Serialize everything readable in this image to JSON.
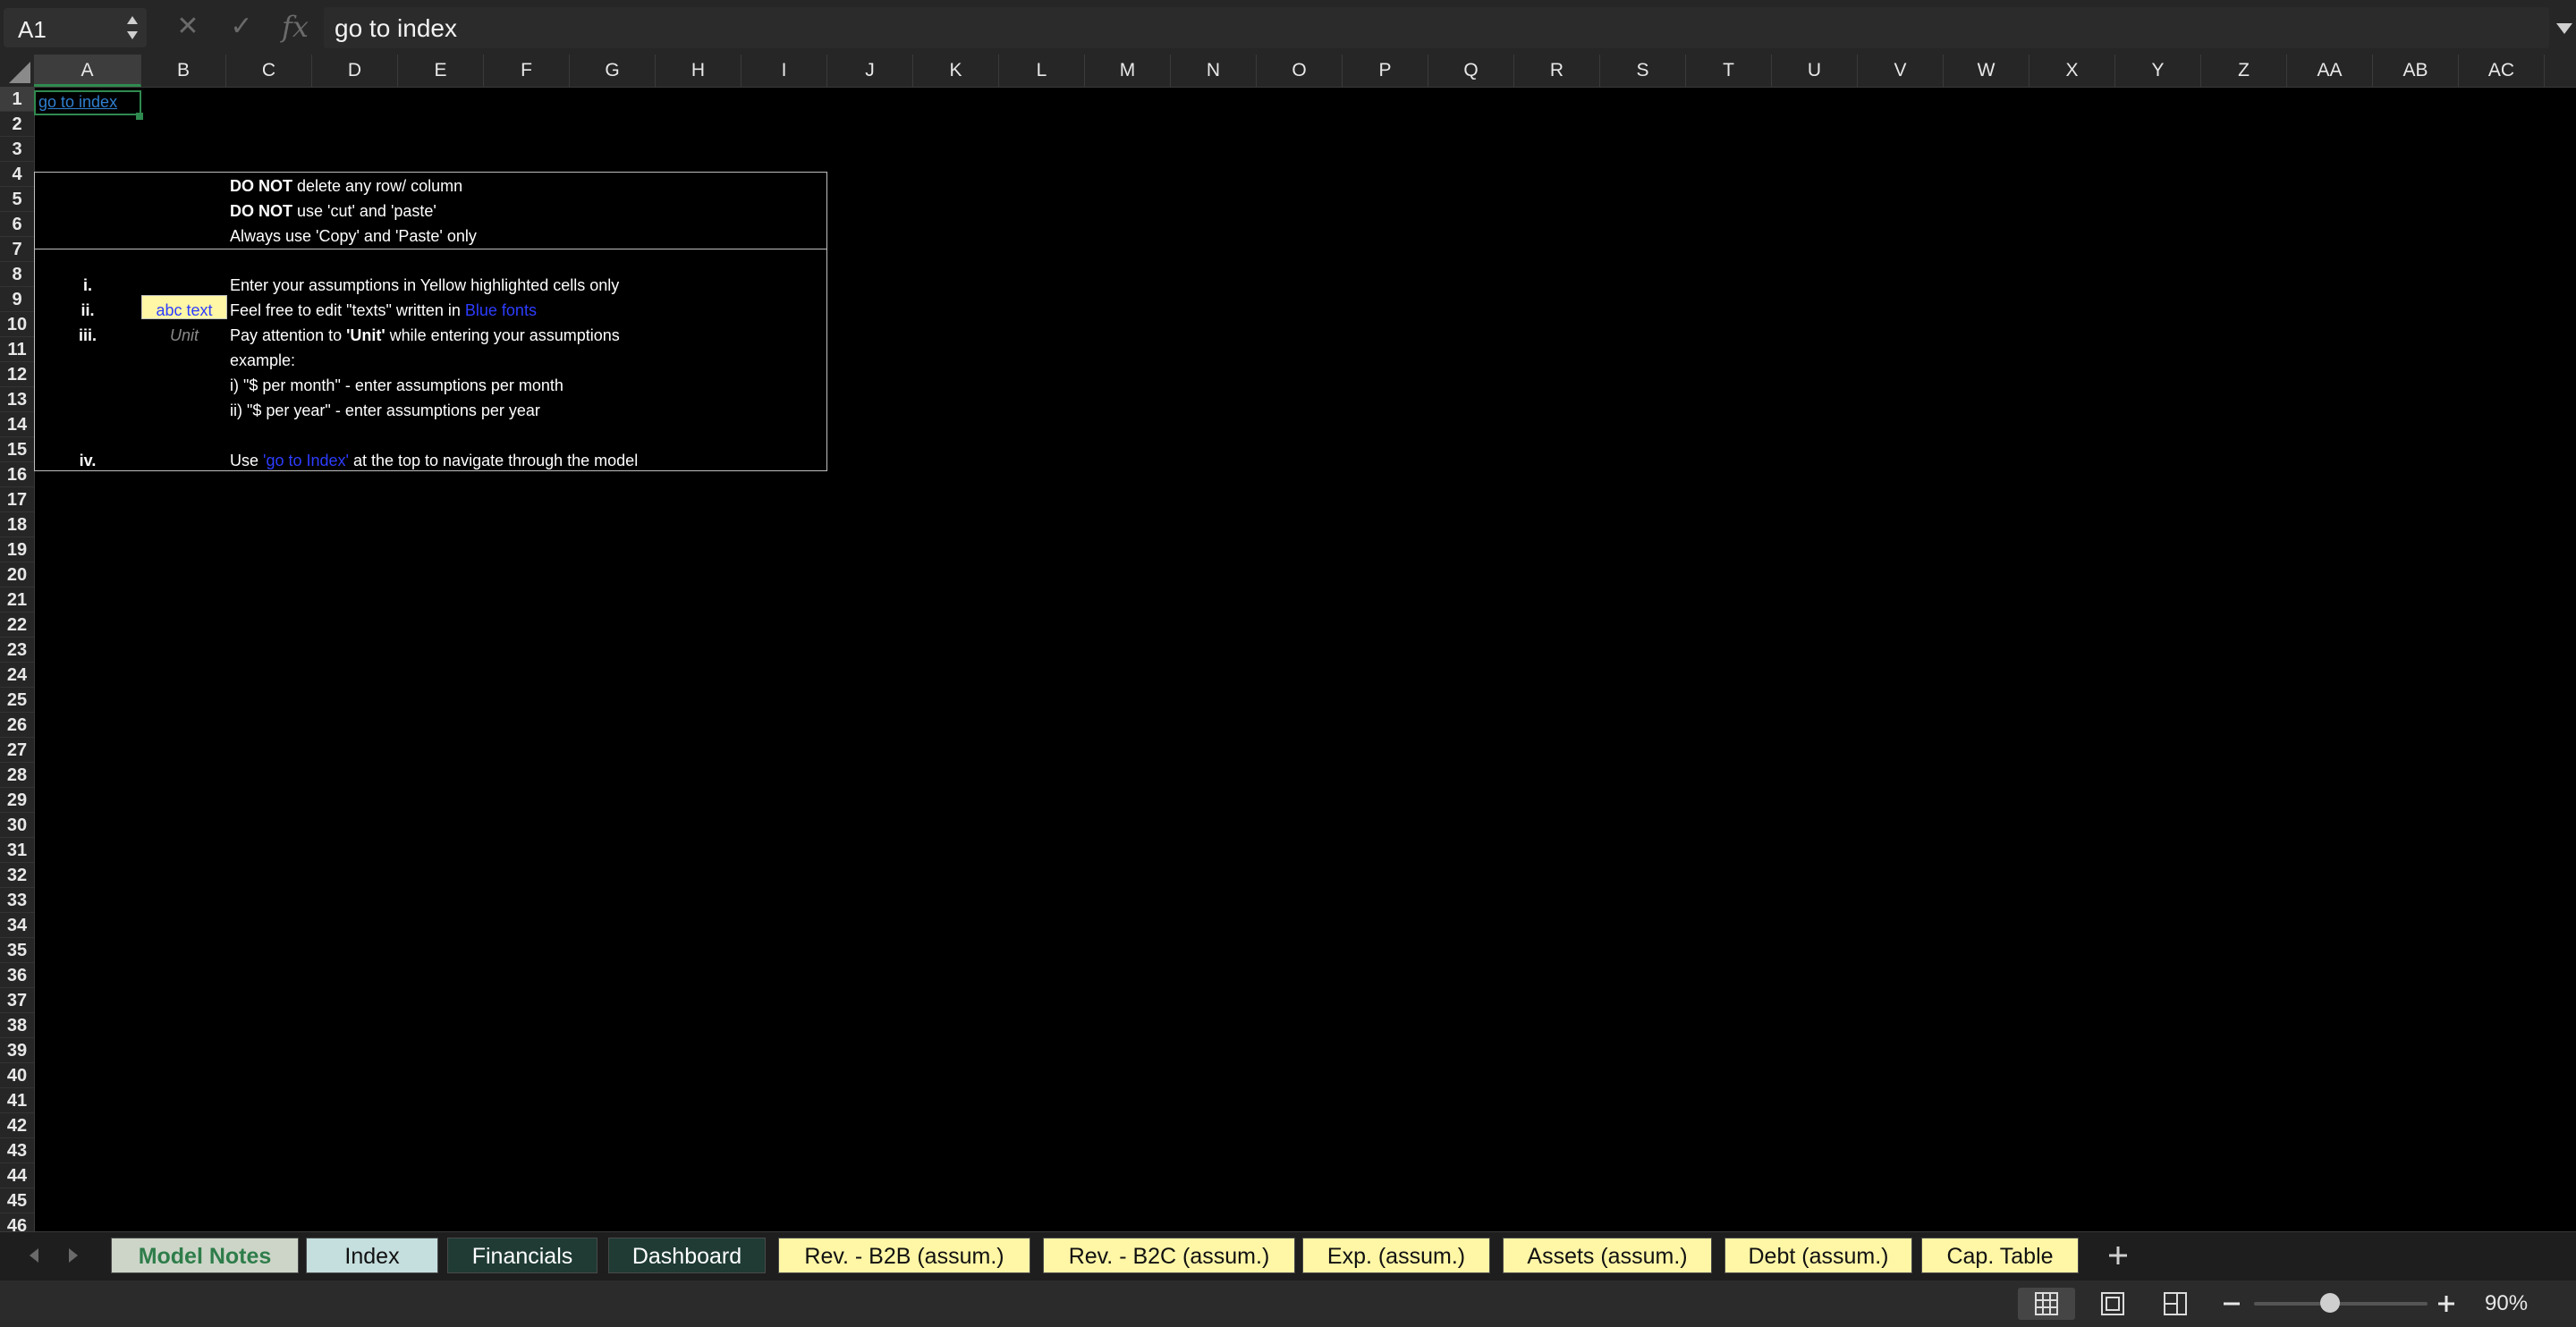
{
  "formula_bar": {
    "name_box": "A1",
    "formula": "go to index"
  },
  "columns": [
    "A",
    "B",
    "C",
    "D",
    "E",
    "F",
    "G",
    "H",
    "I",
    "J",
    "K",
    "L",
    "M",
    "N",
    "O",
    "P",
    "Q",
    "R",
    "S",
    "T",
    "U",
    "V",
    "W",
    "X",
    "Y",
    "Z",
    "AA",
    "AB",
    "AC"
  ],
  "rows": [
    "1",
    "2",
    "3",
    "4",
    "5",
    "6",
    "7",
    "8",
    "9",
    "10",
    "11",
    "12",
    "13",
    "14",
    "15",
    "16",
    "17",
    "18",
    "19",
    "20",
    "21",
    "22",
    "23",
    "24",
    "25",
    "26",
    "27",
    "28",
    "29",
    "30",
    "31",
    "32",
    "33",
    "34",
    "35",
    "36",
    "37",
    "38",
    "39",
    "40",
    "41",
    "42",
    "43",
    "44",
    "45",
    "46"
  ],
  "sheet": {
    "a1_link": "go to index",
    "warnings": {
      "r3_bold": "DO NOT",
      "r3_rest": " delete any row/ column",
      "r4_bold": "DO NOT",
      "r4_rest": " use 'cut' and 'paste'",
      "r5": "Always use 'Copy' and 'Paste' only"
    },
    "instructions": {
      "i_num": "i.",
      "i_text": "Enter your assumptions in Yellow highlighted cells only",
      "ii_num": "ii.",
      "ii_sample": "abc text",
      "ii_text_pre": "Feel free to edit \"texts\" written in ",
      "ii_text_blue": "Blue fonts",
      "iii_num": "iii.",
      "iii_sample": "Unit",
      "iii_text_pre": "Pay attention to ",
      "iii_text_bold": "'Unit'",
      "iii_text_post": " while entering your assumptions",
      "r10": "example:",
      "r11": "i)  \"$ per month\" - enter assumptions per month",
      "r12": "ii) \"$ per year\" - enter assumptions per year",
      "iv_num": "iv.",
      "iv_text_pre": "Use ",
      "iv_text_blue": "'go to Index'",
      "iv_text_post": " at the top to navigate through the model"
    }
  },
  "tabs": [
    {
      "label": "Model Notes",
      "bg": "#cdd5c8",
      "fg": "#2e7d4a",
      "active": true
    },
    {
      "label": "Index",
      "bg": "#c5dede",
      "fg": "#111111",
      "active": false
    },
    {
      "label": "Financials",
      "bg": "#1f3b34",
      "fg": "#ffffff",
      "active": false
    },
    {
      "label": "Dashboard",
      "bg": "#1f3b34",
      "fg": "#ffffff",
      "active": false
    },
    {
      "label": "Rev. - B2B (assum.)",
      "bg": "#fff6a6",
      "fg": "#111111",
      "active": false
    },
    {
      "label": "Rev. - B2C (assum.)",
      "bg": "#fff6a6",
      "fg": "#111111",
      "active": false
    },
    {
      "label": "Exp. (assum.)",
      "bg": "#fff6a6",
      "fg": "#111111",
      "active": false
    },
    {
      "label": "Assets (assum.)",
      "bg": "#fff6a6",
      "fg": "#111111",
      "active": false
    },
    {
      "label": "Debt (assum.)",
      "bg": "#fff6a6",
      "fg": "#111111",
      "active": false
    },
    {
      "label": "Cap. Table",
      "bg": "#fff6a6",
      "fg": "#111111",
      "active": false
    }
  ],
  "status": {
    "zoom": "90%"
  },
  "colors": {
    "selection": "#2f8a4f",
    "link": "#2f7fcf",
    "input_yellow": "#fff6a6",
    "blue_font": "#2d3dff"
  }
}
